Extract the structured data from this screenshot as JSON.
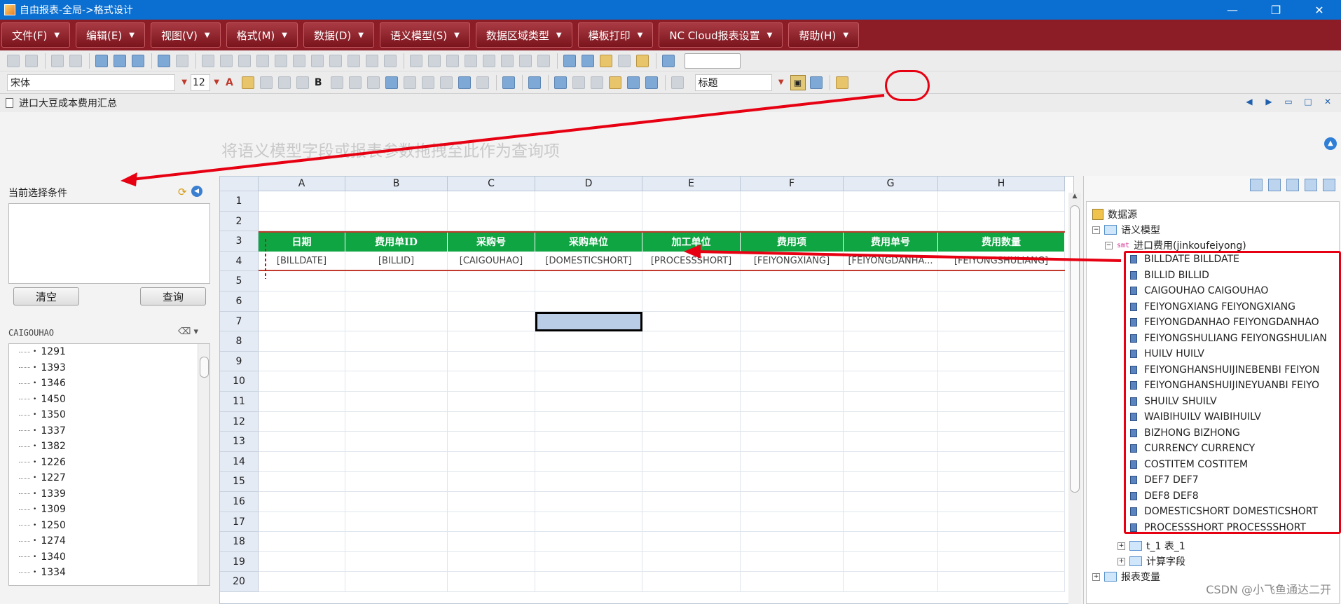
{
  "window": {
    "title": "自由报表-全局->格式设计",
    "minimize": "—",
    "restore": "❐",
    "close": "✕"
  },
  "menus": [
    "文件(F)",
    "编辑(E)",
    "视图(V)",
    "格式(M)",
    "数据(D)",
    "语义模型(S)",
    "数据区域类型",
    "模板打印",
    "NC Cloud报表设置",
    "帮助(H)"
  ],
  "toolbar": {
    "font": "宋体",
    "size": "12",
    "style": "标题",
    "bold": "B",
    "font_color": "A"
  },
  "doc_tab": {
    "title": "进口大豆成本费用汇总"
  },
  "query_hint": "将语义模型字段或报表参数拖拽至此作为查询项",
  "left_panel": {
    "title": "当前选择条件",
    "clear_label": "清空",
    "query_label": "查询",
    "field_label": "CAIGOUHAO",
    "values": [
      "1291",
      "1393",
      "1346",
      "1450",
      "1350",
      "1337",
      "1382",
      "1226",
      "1227",
      "1339",
      "1309",
      "1250",
      "1274",
      "1340",
      "1334"
    ]
  },
  "sheet": {
    "columns": [
      "A",
      "B",
      "C",
      "D",
      "E",
      "F",
      "G",
      "H"
    ],
    "rows": [
      "1",
      "2",
      "3",
      "4",
      "5",
      "6",
      "7",
      "8",
      "9",
      "10",
      "11",
      "12",
      "13",
      "14",
      "15",
      "16",
      "17",
      "18",
      "19",
      "20"
    ],
    "header_row": [
      "日期",
      "费用单ID",
      "采购号",
      "采购单位",
      "加工单位",
      "费用项",
      "费用单号",
      "费用数量"
    ],
    "data_row": [
      "[BILLDATE]",
      "[BILLID]",
      "[CAIGOUHAO]",
      "[DOMESTICSHORT]",
      "[PROCESSSHORT]",
      "[FEIYONGXIANG]",
      "[FEIYONGDANHA...",
      "[FEIYONGSHULIANG]"
    ],
    "header_color": "#10a543"
  },
  "tree": {
    "datasource": "数据源",
    "semantic_model": "语义模型",
    "smt_tag": "smt",
    "model_name": "进口费用(jinkoufeiyong)",
    "fields": [
      "BILLDATE  BILLDATE",
      "BILLID  BILLID",
      "CAIGOUHAO  CAIGOUHAO",
      "FEIYONGXIANG  FEIYONGXIANG",
      "FEIYONGDANHAO  FEIYONGDANHAO",
      "FEIYONGSHULIANG  FEIYONGSHULIAN",
      "HUILV  HUILV",
      "FEIYONGHANSHUIJINEBENBI  FEIYON",
      "FEIYONGHANSHUIJINEYUANBI  FEIYO",
      "SHUILV  SHUILV",
      "WAIBIHUILV  WAIBIHUILV",
      "BIZHONG  BIZHONG",
      "CURRENCY  CURRENCY",
      "COSTITEM  COSTITEM",
      "DEF7  DEF7",
      "DEF8  DEF8",
      "DOMESTICSHORT  DOMESTICSHORT",
      "PROCESSSHORT  PROCESSSHORT"
    ],
    "table1": "t_1  表_1",
    "calc_fields": "计算字段",
    "report_vars": "报表变量"
  },
  "watermark": "CSDN @小飞鱼通达二开",
  "accent_colors": {
    "menubar": "#8c1c25",
    "titlebar": "#0b6fd1",
    "annotation": "#e60012"
  }
}
